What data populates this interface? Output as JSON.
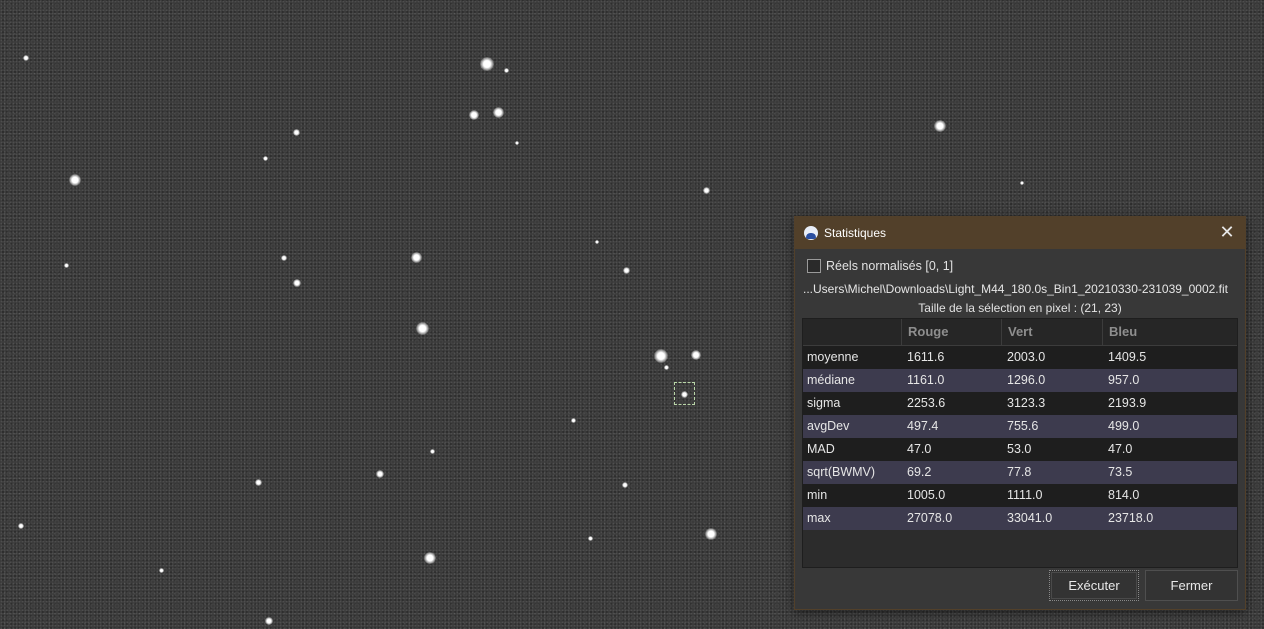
{
  "dialog": {
    "title": "Statistiques",
    "close_glyph": "✕",
    "normalize_label": "Réels normalisés [0, 1]",
    "normalize_checked": false,
    "file_path": "...Users\\Michel\\Downloads\\Light_M44_180.0s_Bin1_20210330-231039_0002.fit",
    "selection_size": "Taille de la sélection en pixel : (21, 23)",
    "table": {
      "headers": [
        "",
        "Rouge",
        "Vert",
        "Bleu"
      ],
      "rows": [
        {
          "label": "moyenne",
          "r": "1611.6",
          "g": "2003.0",
          "b": "1409.5"
        },
        {
          "label": "médiane",
          "r": "1161.0",
          "g": "1296.0",
          "b": "957.0"
        },
        {
          "label": "sigma",
          "r": "2253.6",
          "g": "3123.3",
          "b": "2193.9"
        },
        {
          "label": "avgDev",
          "r": "497.4",
          "g": "755.6",
          "b": "499.0"
        },
        {
          "label": "MAD",
          "r": "47.0",
          "g": "53.0",
          "b": "47.0"
        },
        {
          "label": "sqrt(BWMV)",
          "r": "69.2",
          "g": "77.8",
          "b": "73.5"
        },
        {
          "label": "min",
          "r": "1005.0",
          "g": "1111.0",
          "b": "814.0"
        },
        {
          "label": "max",
          "r": "27078.0",
          "g": "33041.0",
          "b": "23718.0"
        }
      ]
    },
    "buttons": {
      "execute": "Exécuter",
      "close": "Fermer"
    },
    "icons": {
      "app": "siril-app-icon",
      "close": "close-icon",
      "checkbox": "checkbox-icon"
    },
    "colors": {
      "titlebar": "#52402a",
      "row_alt": "#3d3b4e"
    }
  }
}
